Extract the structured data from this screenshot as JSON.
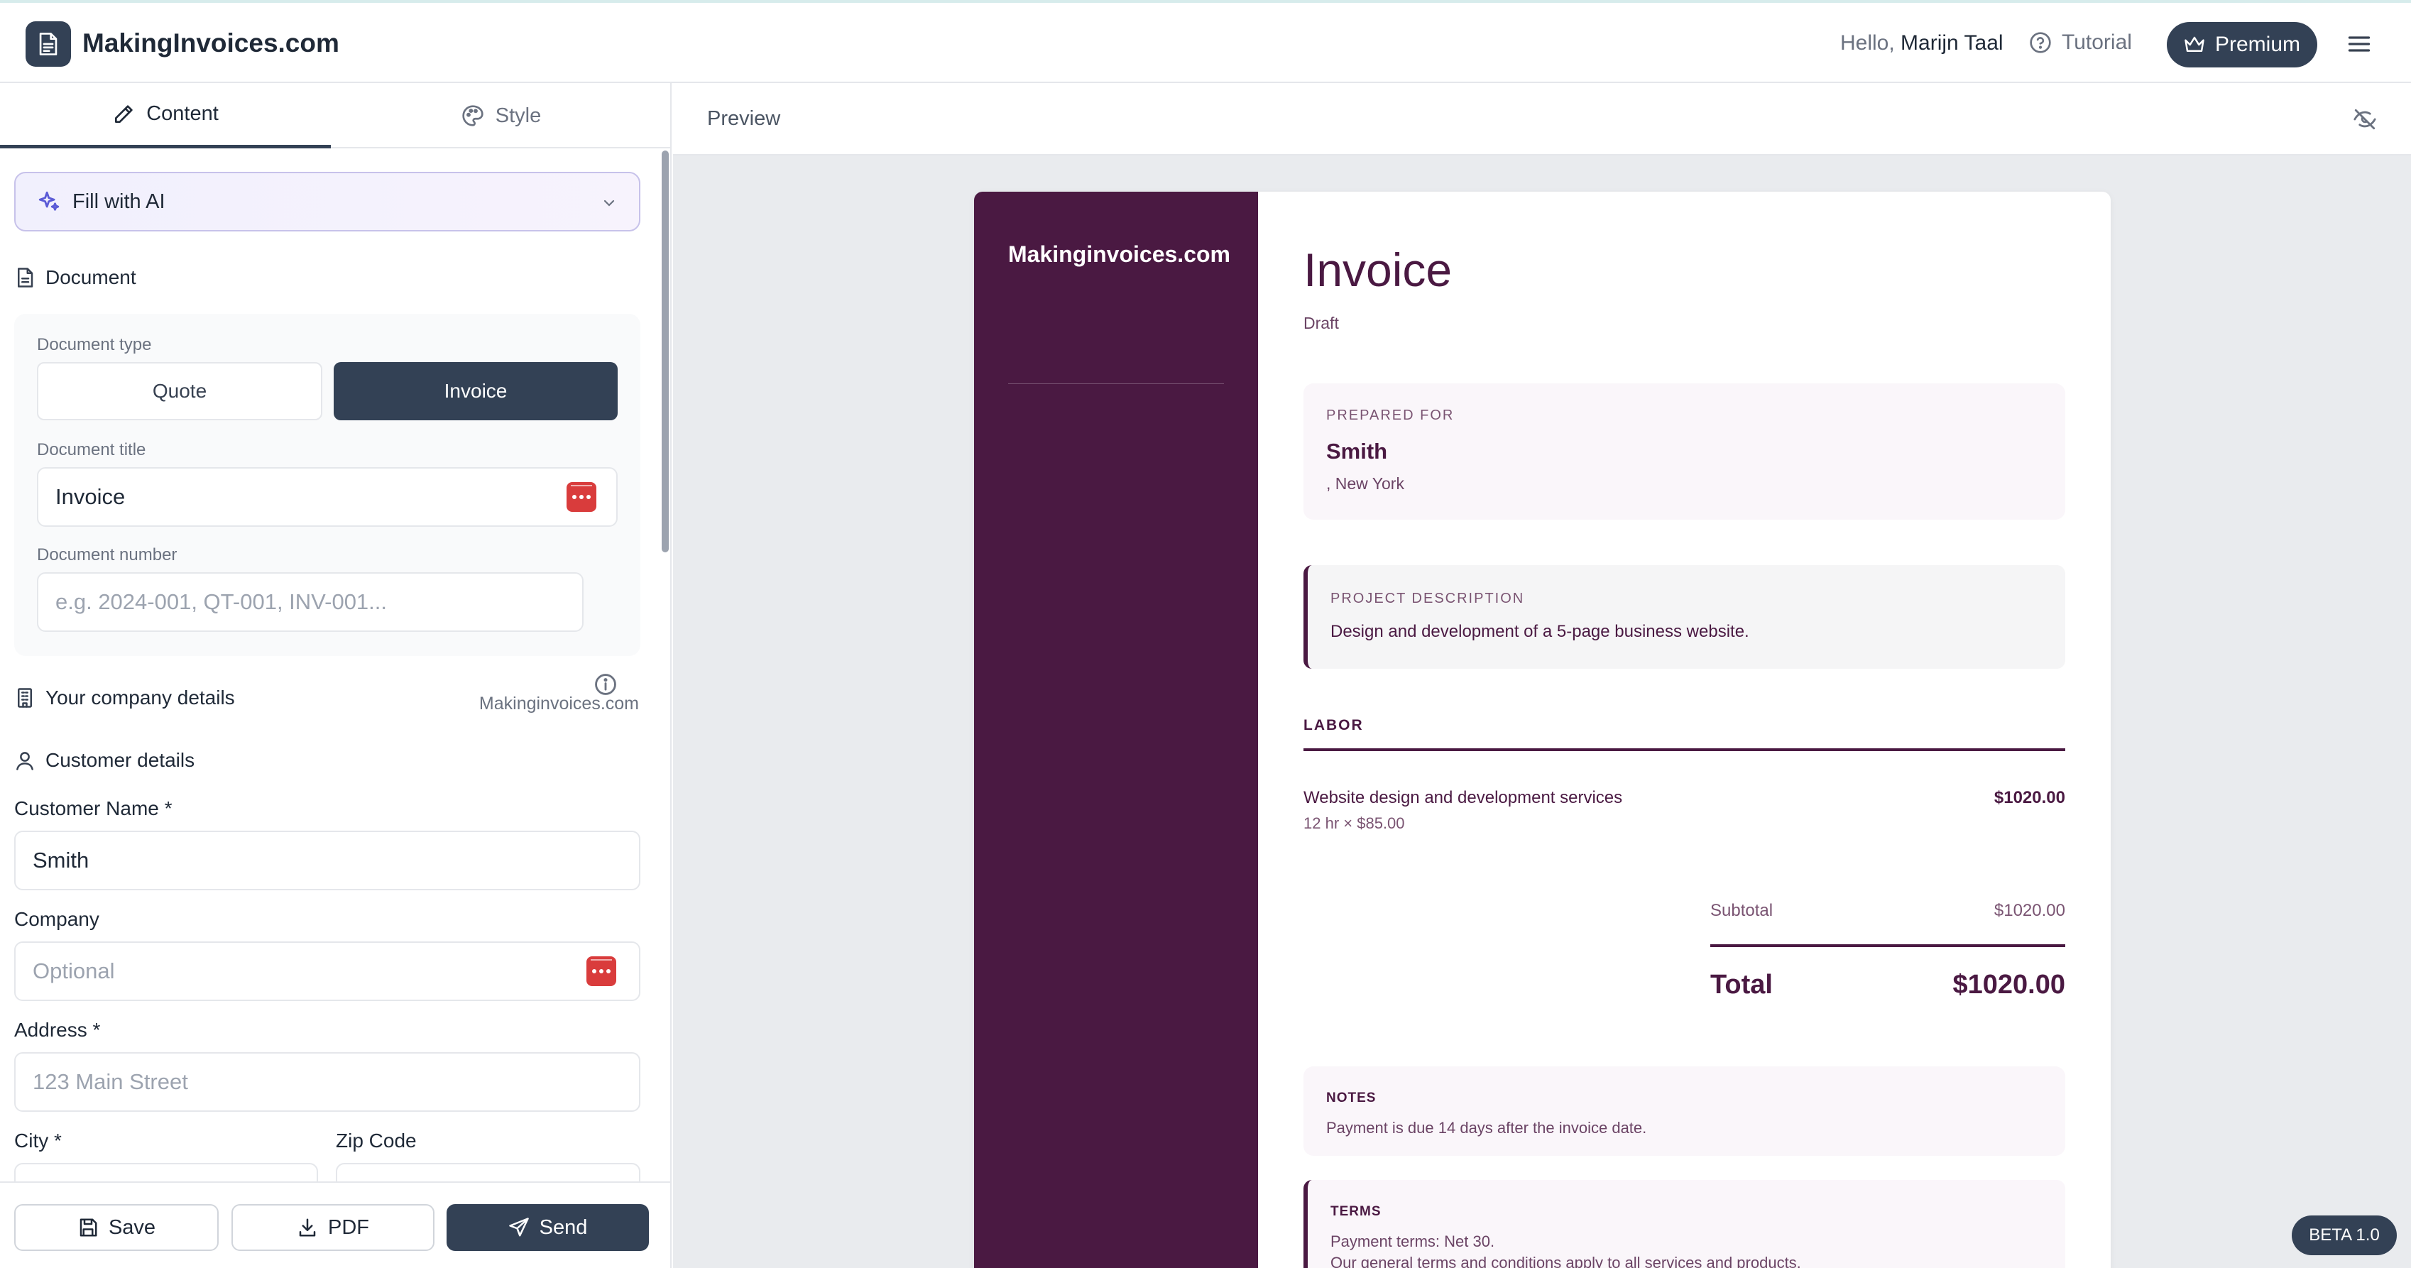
{
  "app": {
    "brand": "MakingInvoices.com",
    "greeting_prefix": "Hello,",
    "user_name": "Marijn Taal",
    "tutorial_label": "Tutorial",
    "premium_label": "Premium"
  },
  "tabs": [
    {
      "label": "Content",
      "active": true,
      "icon": "pencil-icon"
    },
    {
      "label": "Style",
      "active": false,
      "icon": "palette-icon"
    }
  ],
  "ai_fill": {
    "label": "Fill with AI",
    "icon": "sparkles-icon"
  },
  "document_section": {
    "title": "Document",
    "type_label": "Document type",
    "types": [
      "Quote",
      "Invoice"
    ],
    "selected_type": "Invoice",
    "title_label": "Document title",
    "title_value": "Invoice",
    "number_label": "Document number",
    "number_placeholder": "e.g. 2024-001, QT-001, INV-001..."
  },
  "company_section": {
    "title": "Your company details",
    "value": "Makinginvoices.com"
  },
  "customer_section": {
    "title": "Customer details",
    "name_label": "Customer Name *",
    "name_value": "Smith",
    "company_label": "Company",
    "company_placeholder": "Optional",
    "address_label": "Address *",
    "address_placeholder": "123 Main Street",
    "city_label": "City *",
    "zip_label": "Zip Code"
  },
  "actions": {
    "save": "Save",
    "pdf": "PDF",
    "send": "Send"
  },
  "preview": {
    "label": "Preview"
  },
  "invoice": {
    "sidebar_brand": "Makinginvoices.com",
    "title": "Invoice",
    "status": "Draft",
    "prepared_for_label": "PREPARED FOR",
    "customer_name": "Smith",
    "customer_location": ", New York",
    "project_label": "PROJECT DESCRIPTION",
    "project_text": "Design and development of a 5-page business website.",
    "labor_label": "LABOR",
    "items": [
      {
        "description": "Website design and development services",
        "detail": "12 hr × $85.00",
        "amount": "$1020.00"
      }
    ],
    "subtotal_label": "Subtotal",
    "subtotal_value": "$1020.00",
    "total_label": "Total",
    "total_value": "$1020.00",
    "notes_label": "NOTES",
    "notes_text": "Payment is due 14 days after the invoice date.",
    "terms_label": "TERMS",
    "terms_line1": "Payment terms: Net 30.",
    "terms_line2": "Our general terms and conditions apply to all services and products."
  },
  "beta_badge": "BETA 1.0",
  "colors": {
    "accent_dark": "#334155",
    "invoice_plum": "#4a1942",
    "ai_border": "#c7c2ea",
    "alert_red": "#d93c3c"
  }
}
